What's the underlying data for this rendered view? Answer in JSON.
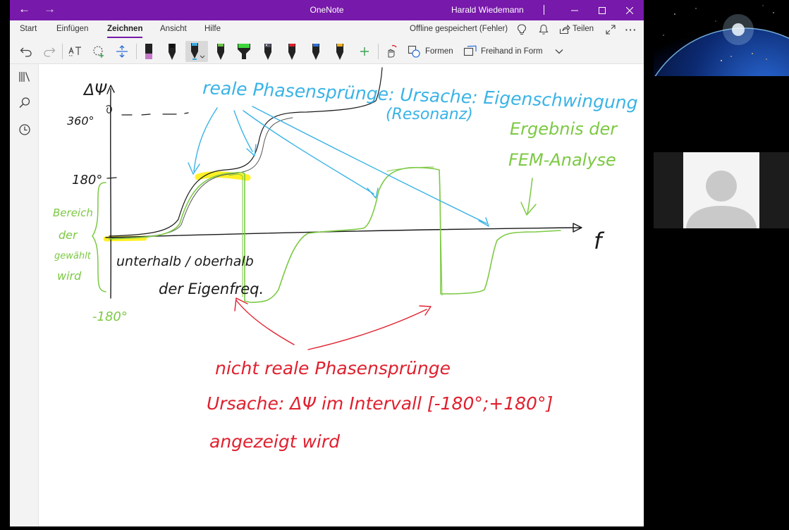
{
  "window": {
    "app_title": "OneNote",
    "user_name": "Harald Wiedemann"
  },
  "menu": {
    "tabs": [
      {
        "label": "Start"
      },
      {
        "label": "Einfügen"
      },
      {
        "label": "Zeichnen"
      },
      {
        "label": "Ansicht"
      },
      {
        "label": "Hilfe"
      }
    ],
    "active_tab": "Zeichnen",
    "sync_status": "Offline gespeichert (Fehler)",
    "share_label": "Teilen"
  },
  "toolbar": {
    "shapes_label": "Formen",
    "ink_to_shape_label": "Freihand in Form",
    "pens": [
      {
        "name": "highlighter-pink",
        "color": "#c678c8"
      },
      {
        "name": "pen-black",
        "color": "#111111"
      },
      {
        "name": "pen-blue-selected",
        "color": "#3aa8e0"
      },
      {
        "name": "pen-green",
        "color": "#6cc24a"
      },
      {
        "name": "highlighter-green",
        "color": "#3dd63d"
      },
      {
        "name": "pen-galaxy",
        "color": "#555566"
      },
      {
        "name": "pen-red",
        "color": "#e0202e"
      },
      {
        "name": "pen-blue-dark",
        "color": "#2e6fd6"
      },
      {
        "name": "pen-yellow",
        "color": "#f2b01e"
      }
    ]
  },
  "sidebar": {
    "icons": [
      "notebooks-icon",
      "search-icon",
      "recent-icon"
    ]
  },
  "ink": {
    "colors": {
      "black": "#1a1a1a",
      "blue": "#3ab3e6",
      "green": "#7cc943",
      "red": "#e0202e",
      "highlight": "#ffee00"
    },
    "texts": {
      "axis_y": "ΔΨ",
      "axis_x": "f",
      "label_360": "360°",
      "label_180": "180°",
      "label_m180": "-180°",
      "left_note": [
        "Bereich",
        "der",
        "gewählt",
        "wird"
      ],
      "top_note_1": "reale Phasensprünge: Ursache: Eigenschwingung",
      "top_note_2": "(Resonanz)",
      "fem_note_1": "Ergebnis der",
      "fem_note_2": "FEM-Analyse",
      "below_note_1": "unterhalb / oberhalb",
      "below_note_2": "der Eigenfreq.",
      "red_note_1": "nicht reale Phasensprünge",
      "red_note_2": "Ursache: ΔΨ im Intervall [-180°;+180°]",
      "red_note_3": "angezeigt wird"
    }
  }
}
